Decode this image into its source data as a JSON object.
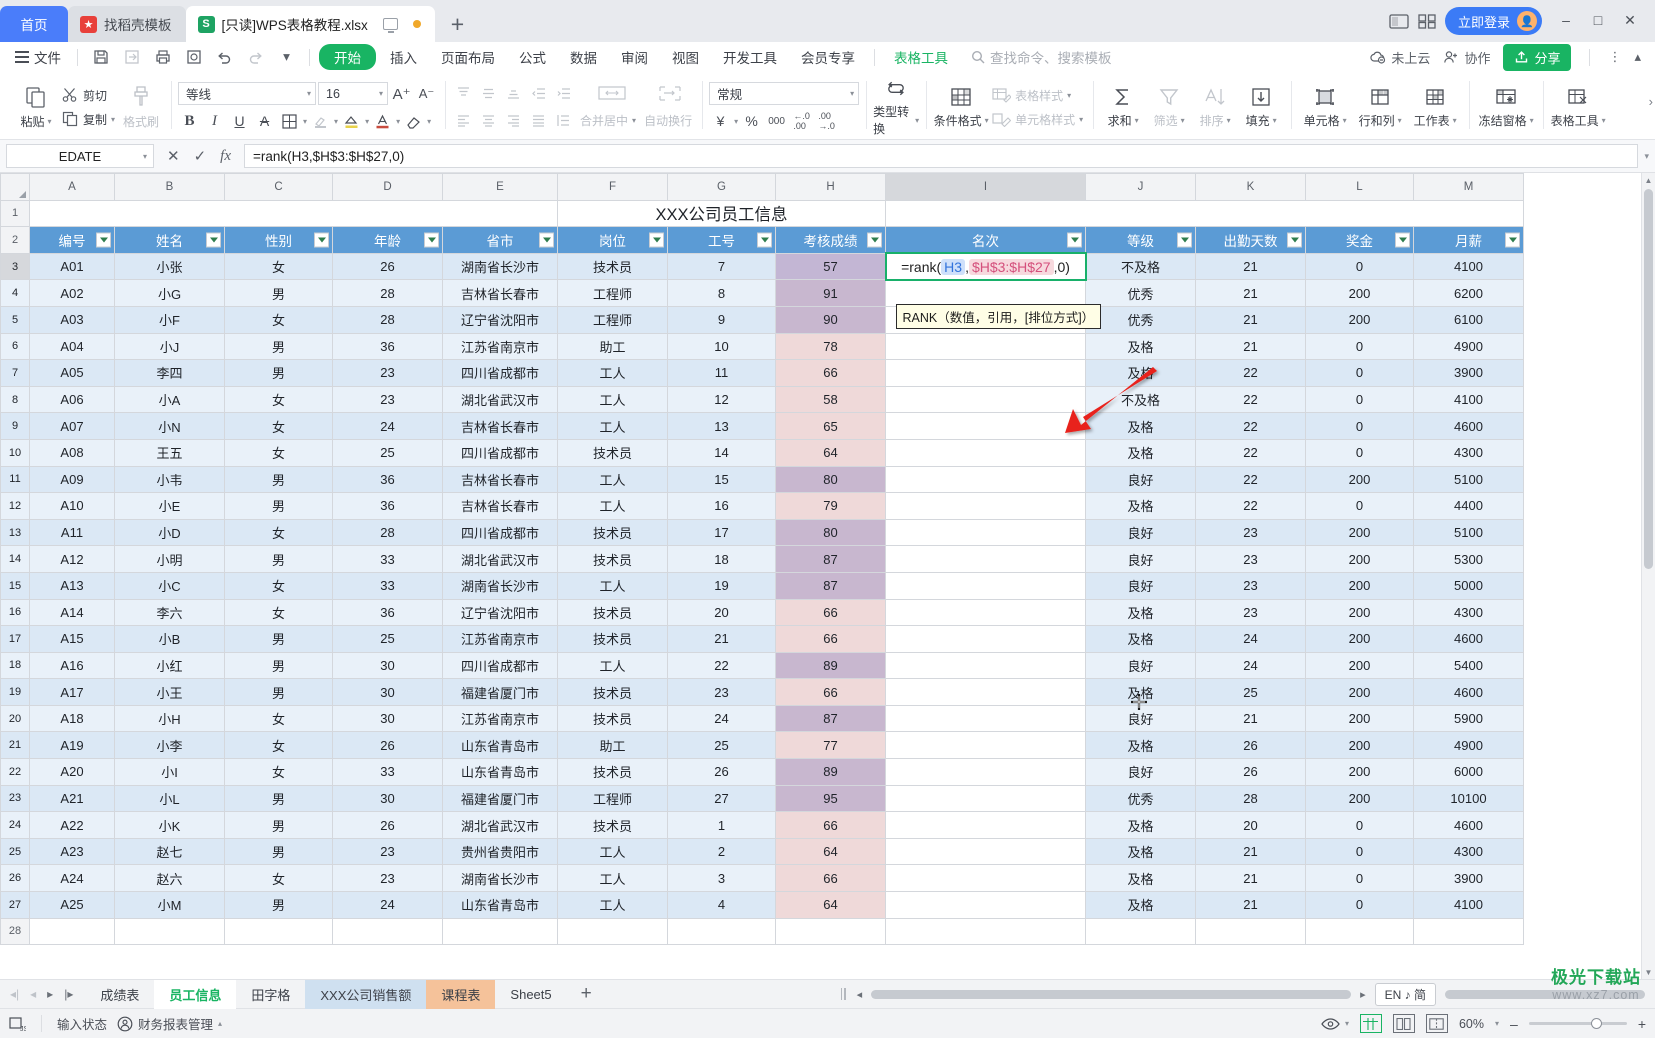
{
  "window": {
    "tabs": [
      {
        "id": "home",
        "label": "首页",
        "icon": null
      },
      {
        "id": "template",
        "label": "找稻壳模板",
        "icon": "docer-icon"
      },
      {
        "id": "doc",
        "label": "[只读]WPS表格教程.xlsx",
        "icon": "sheet-icon",
        "active": true
      }
    ],
    "new_tab": "+",
    "login_label": "立即登录",
    "controls": {
      "minimize": "–",
      "maximize": "□",
      "close": "✕"
    }
  },
  "menu": {
    "file_label": "文件",
    "quick": [
      "save-icon",
      "save-as-icon",
      "print-icon",
      "print-preview-icon",
      "undo-icon",
      "redo-icon",
      "customize-caret-icon"
    ],
    "items": [
      "开始",
      "插入",
      "页面布局",
      "公式",
      "数据",
      "审阅",
      "视图",
      "开发工具",
      "会员专享"
    ],
    "selected": "开始",
    "context_tab": "表格工具",
    "search_placeholder": "查找命令、搜索模板",
    "right": [
      {
        "label": "未上云",
        "icon": "cloud-off-icon"
      },
      {
        "label": "协作",
        "icon": "collab-icon"
      },
      {
        "label": "分享",
        "icon": "share-icon"
      }
    ],
    "more_icon": "more-vertical-icon",
    "collapse_icon": "chevron-up-icon"
  },
  "ribbon": {
    "clipboard": {
      "paste": "粘贴",
      "cut": "剪切",
      "copy": "复制",
      "format_painter": "格式刷"
    },
    "font": {
      "family": "等线",
      "size": "16",
      "grow": "A+",
      "shrink": "A-",
      "bold": "B",
      "italic": "I",
      "underline": "U",
      "strike": "A",
      "borders": "borders-icon",
      "highlight": "highlight-icon",
      "fill": "fill-color-icon",
      "fontcolor": "font-color-icon",
      "clear": "eraser-icon"
    },
    "alignment": {
      "merge_center": "合并居中",
      "wrap_text": "自动换行"
    },
    "number": {
      "format": "常规",
      "currency": "¥",
      "percent": "%",
      "comma": "000",
      "dec_inc": ".00",
      "dec_dec": ".00",
      "type_convert": "类型转换"
    },
    "styles": {
      "conditional": "条件格式",
      "table_style": "表格样式",
      "cell_style": "单元格样式"
    },
    "editing": {
      "sum": "求和",
      "filter": "筛选",
      "sort": "排序",
      "fill": "填充"
    },
    "cells": {
      "cell": "单元格",
      "rows_cols": "行和列",
      "worksheet": "工作表",
      "freeze": "冻结窗格",
      "table_tools": "表格工具"
    },
    "expand_icon": "chevron-right-icon"
  },
  "formula_bar": {
    "name_box": "EDATE",
    "cancel": "✕",
    "confirm": "✓",
    "fx": "fx",
    "formula": "=rank(H3,$H$3:$H$27,0)",
    "expand": "▾"
  },
  "sheet": {
    "column_headers": [
      "A",
      "B",
      "C",
      "D",
      "E",
      "F",
      "G",
      "H",
      "I",
      "J",
      "K",
      "L",
      "M"
    ],
    "selected_column": "I",
    "title": "XXX公司员工信息",
    "title_row": 1,
    "header_row": 2,
    "headers": [
      "编号",
      "姓名",
      "性别",
      "年龄",
      "省市",
      "岗位",
      "工号",
      "考核成绩",
      "名次",
      "等级",
      "出勤天数",
      "奖金",
      "月薪"
    ],
    "rows": [
      {
        "n": 3,
        "c": [
          "A01",
          "小张",
          "女",
          "26",
          "湖南省长沙市",
          "技术员",
          "7",
          "57",
          "",
          "不及格",
          "21",
          "0",
          "4100"
        ]
      },
      {
        "n": 4,
        "c": [
          "A02",
          "小G",
          "男",
          "28",
          "吉林省长春市",
          "工程师",
          "8",
          "91",
          "",
          "优秀",
          "21",
          "200",
          "6200"
        ]
      },
      {
        "n": 5,
        "c": [
          "A03",
          "小F",
          "女",
          "28",
          "辽宁省沈阳市",
          "工程师",
          "9",
          "90",
          "",
          "优秀",
          "21",
          "200",
          "6100"
        ]
      },
      {
        "n": 6,
        "c": [
          "A04",
          "小J",
          "男",
          "36",
          "江苏省南京市",
          "助工",
          "10",
          "78",
          "",
          "及格",
          "21",
          "0",
          "4900"
        ]
      },
      {
        "n": 7,
        "c": [
          "A05",
          "李四",
          "男",
          "23",
          "四川省成都市",
          "工人",
          "11",
          "66",
          "",
          "及格",
          "22",
          "0",
          "3900"
        ]
      },
      {
        "n": 8,
        "c": [
          "A06",
          "小A",
          "女",
          "23",
          "湖北省武汉市",
          "工人",
          "12",
          "58",
          "",
          "不及格",
          "22",
          "0",
          "4100"
        ]
      },
      {
        "n": 9,
        "c": [
          "A07",
          "小N",
          "女",
          "24",
          "吉林省长春市",
          "工人",
          "13",
          "65",
          "",
          "及格",
          "22",
          "0",
          "4600"
        ]
      },
      {
        "n": 10,
        "c": [
          "A08",
          "王五",
          "女",
          "25",
          "四川省成都市",
          "技术员",
          "14",
          "64",
          "",
          "及格",
          "22",
          "0",
          "4300"
        ]
      },
      {
        "n": 11,
        "c": [
          "A09",
          "小韦",
          "男",
          "36",
          "吉林省长春市",
          "工人",
          "15",
          "80",
          "",
          "良好",
          "22",
          "200",
          "5100"
        ]
      },
      {
        "n": 12,
        "c": [
          "A10",
          "小E",
          "男",
          "36",
          "吉林省长春市",
          "工人",
          "16",
          "79",
          "",
          "及格",
          "22",
          "0",
          "4400"
        ]
      },
      {
        "n": 13,
        "c": [
          "A11",
          "小D",
          "女",
          "28",
          "四川省成都市",
          "技术员",
          "17",
          "80",
          "",
          "良好",
          "23",
          "200",
          "5100"
        ]
      },
      {
        "n": 14,
        "c": [
          "A12",
          "小明",
          "男",
          "33",
          "湖北省武汉市",
          "技术员",
          "18",
          "87",
          "",
          "良好",
          "23",
          "200",
          "5300"
        ]
      },
      {
        "n": 15,
        "c": [
          "A13",
          "小C",
          "女",
          "33",
          "湖南省长沙市",
          "工人",
          "19",
          "87",
          "",
          "良好",
          "23",
          "200",
          "5000"
        ]
      },
      {
        "n": 16,
        "c": [
          "A14",
          "李六",
          "女",
          "36",
          "辽宁省沈阳市",
          "技术员",
          "20",
          "66",
          "",
          "及格",
          "23",
          "200",
          "4300"
        ]
      },
      {
        "n": 17,
        "c": [
          "A15",
          "小B",
          "男",
          "25",
          "江苏省南京市",
          "技术员",
          "21",
          "66",
          "",
          "及格",
          "24",
          "200",
          "4600"
        ]
      },
      {
        "n": 18,
        "c": [
          "A16",
          "小红",
          "男",
          "30",
          "四川省成都市",
          "工人",
          "22",
          "89",
          "",
          "良好",
          "24",
          "200",
          "5400"
        ]
      },
      {
        "n": 19,
        "c": [
          "A17",
          "小王",
          "男",
          "30",
          "福建省厦门市",
          "技术员",
          "23",
          "66",
          "",
          "及格",
          "25",
          "200",
          "4600"
        ]
      },
      {
        "n": 20,
        "c": [
          "A18",
          "小H",
          "女",
          "30",
          "江苏省南京市",
          "技术员",
          "24",
          "87",
          "",
          "良好",
          "21",
          "200",
          "5900"
        ]
      },
      {
        "n": 21,
        "c": [
          "A19",
          "小李",
          "女",
          "26",
          "山东省青岛市",
          "助工",
          "25",
          "77",
          "",
          "及格",
          "26",
          "200",
          "4900"
        ]
      },
      {
        "n": 22,
        "c": [
          "A20",
          "小I",
          "女",
          "33",
          "山东省青岛市",
          "技术员",
          "26",
          "89",
          "",
          "良好",
          "26",
          "200",
          "6000"
        ]
      },
      {
        "n": 23,
        "c": [
          "A21",
          "小L",
          "男",
          "30",
          "福建省厦门市",
          "工程师",
          "27",
          "95",
          "",
          "优秀",
          "28",
          "200",
          "10100"
        ]
      },
      {
        "n": 24,
        "c": [
          "A22",
          "小K",
          "男",
          "26",
          "湖北省武汉市",
          "技术员",
          "1",
          "66",
          "",
          "及格",
          "20",
          "0",
          "4600"
        ]
      },
      {
        "n": 25,
        "c": [
          "A23",
          "赵七",
          "男",
          "23",
          "贵州省贵阳市",
          "工人",
          "2",
          "64",
          "",
          "及格",
          "21",
          "0",
          "4300"
        ]
      },
      {
        "n": 26,
        "c": [
          "A24",
          "赵六",
          "女",
          "23",
          "湖南省长沙市",
          "工人",
          "3",
          "66",
          "",
          "及格",
          "21",
          "0",
          "3900"
        ]
      },
      {
        "n": 27,
        "c": [
          "A25",
          "小M",
          "男",
          "24",
          "山东省青岛市",
          "工人",
          "4",
          "64",
          "",
          "及格",
          "21",
          "0",
          "4100"
        ]
      }
    ],
    "trailing_row": 28,
    "editing_cell": {
      "ref": "I3",
      "formula_prefix": "=rank(",
      "token1": "H3",
      "sep1": ",",
      "token2": "$H$3:$H$27",
      "sep2": ",",
      "tail": "0)"
    },
    "tooltip": "RANK（数值，引用，[排位方式]）"
  },
  "sheet_tabs": {
    "nav": [
      "first",
      "prev",
      "next",
      "last"
    ],
    "items": [
      {
        "label": "成绩表",
        "style": "plain"
      },
      {
        "label": "员工信息",
        "style": "active"
      },
      {
        "label": "田字格",
        "style": "plain"
      },
      {
        "label": "XXX公司销售额",
        "style": "blue"
      },
      {
        "label": "课程表",
        "style": "orange"
      },
      {
        "label": "Sheet5",
        "style": "plain"
      }
    ],
    "add": "+",
    "ime": "EN ♪ 简"
  },
  "status_bar": {
    "macro_icon": "macro-icon",
    "input_state": "输入状态",
    "finance_tool": "财务报表管理",
    "views": [
      "normal-view-icon",
      "page-layout-icon",
      "page-break-icon"
    ],
    "eye_icon": "eye-icon",
    "zoom": "60%",
    "zoom_out": "–",
    "zoom_in": "+"
  },
  "watermark": {
    "line1": "极光下载站",
    "line2": "www.xz7.com"
  },
  "colors": {
    "accent_green": "#19b463",
    "header_blue": "#5b9bd5",
    "row_blue": "#dbe8f5",
    "highlight_pink": "#efd9d9",
    "selection_red": "#b4483f",
    "edit_green": "#18b06a",
    "tab_blue": "#4a7dfa"
  }
}
